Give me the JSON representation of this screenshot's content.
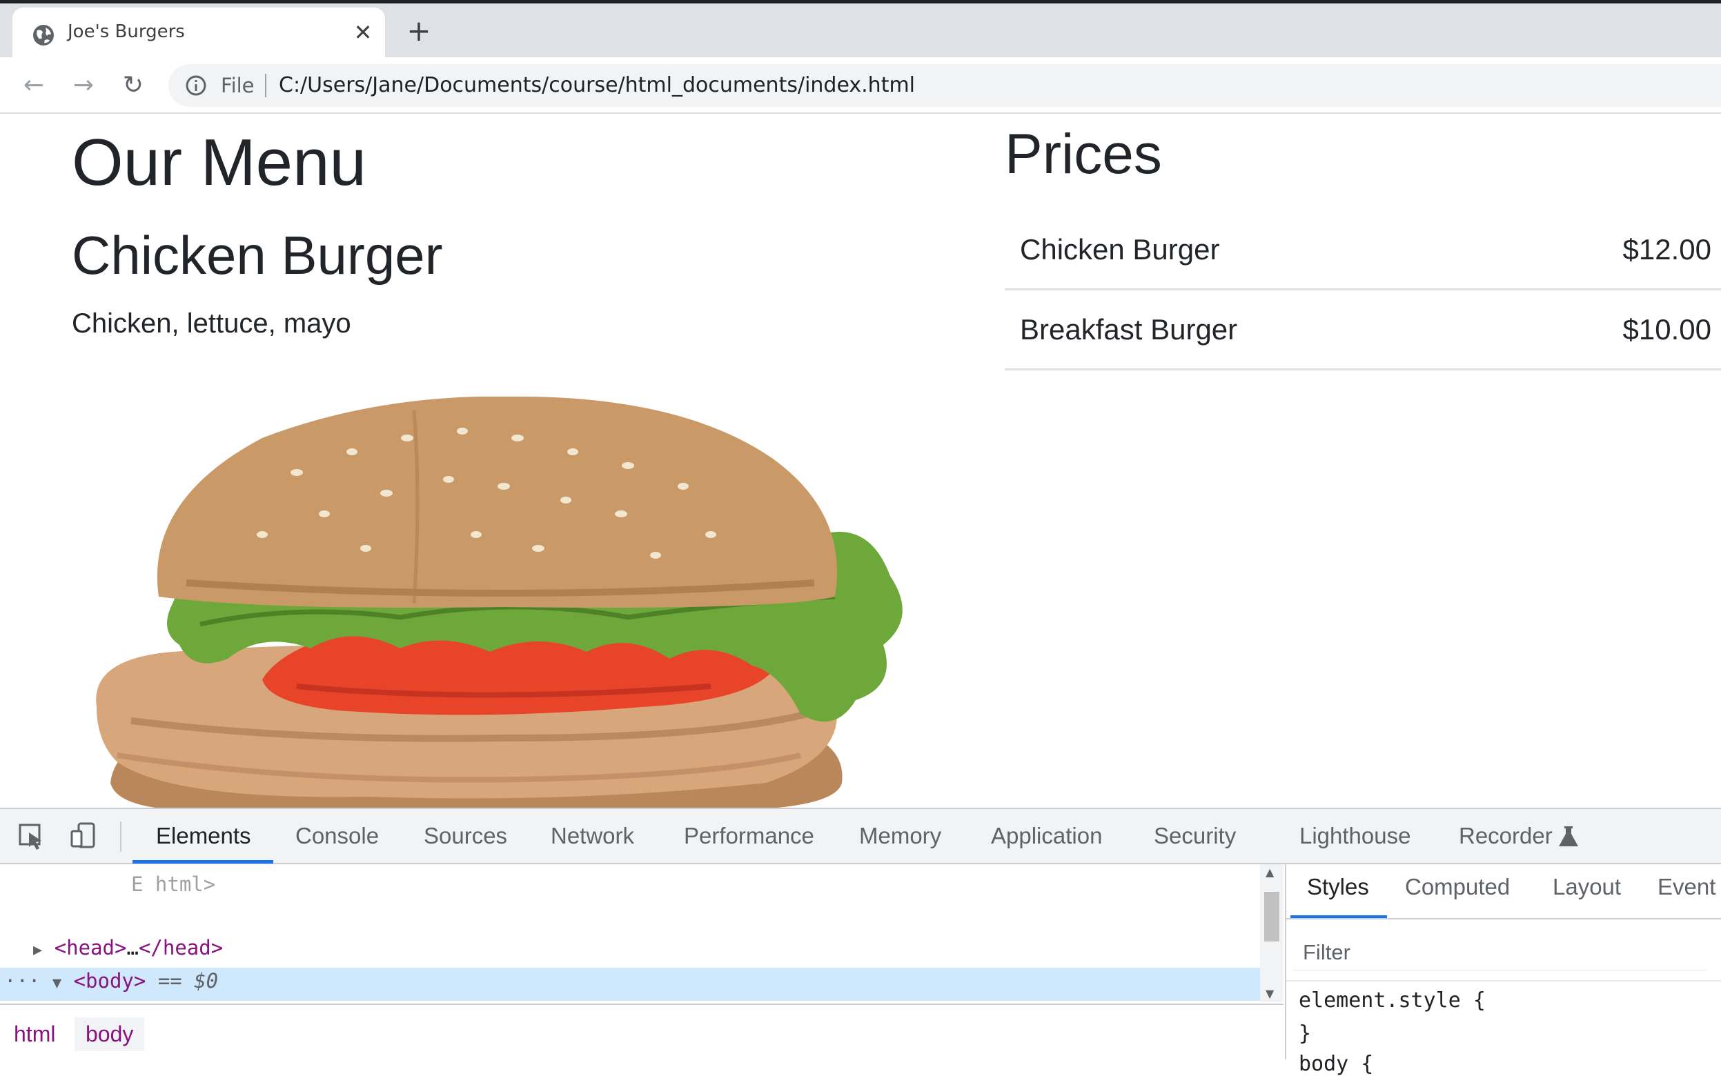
{
  "browser": {
    "tab_title": "Joe's Burgers",
    "tab_icon": "globe-icon",
    "close_glyph": "✕",
    "new_tab_glyph": "+",
    "back_glyph": "←",
    "forward_glyph": "→",
    "reload_glyph": "↻",
    "scheme_label": "File",
    "url": "C:/Users/Jane/Documents/course/html_documents/index.html"
  },
  "page": {
    "menu_heading": "Our Menu",
    "item_name": "Chicken Burger",
    "item_description": "Chicken, lettuce, mayo",
    "prices_heading": "Prices",
    "prices": [
      {
        "name": "Chicken Burger",
        "price": "$12.00"
      },
      {
        "name": "Breakfast Burger",
        "price": "$10.00"
      }
    ]
  },
  "devtools": {
    "tabs": [
      "Elements",
      "Console",
      "Sources",
      "Network",
      "Performance",
      "Memory",
      "Application",
      "Security",
      "Lighthouse",
      "Recorder"
    ],
    "active_tab": "Elements",
    "dom": {
      "faded_line": "E html>",
      "head_open": "<head>",
      "head_ellipsis": "…",
      "head_close": "</head>",
      "body_tag": "<body>",
      "body_marker": "== $0",
      "row_dots": "···"
    },
    "breadcrumbs": [
      "html",
      "body"
    ],
    "styles_tabs": [
      "Styles",
      "Computed",
      "Layout",
      "Event"
    ],
    "filter_placeholder": "Filter",
    "element_style_open": "element.style {",
    "element_style_close": "}",
    "body_rule_partial": "body {"
  },
  "colors": {
    "accent": "#1a73e8",
    "tag": "#881280",
    "selection": "#cfe8fc"
  }
}
